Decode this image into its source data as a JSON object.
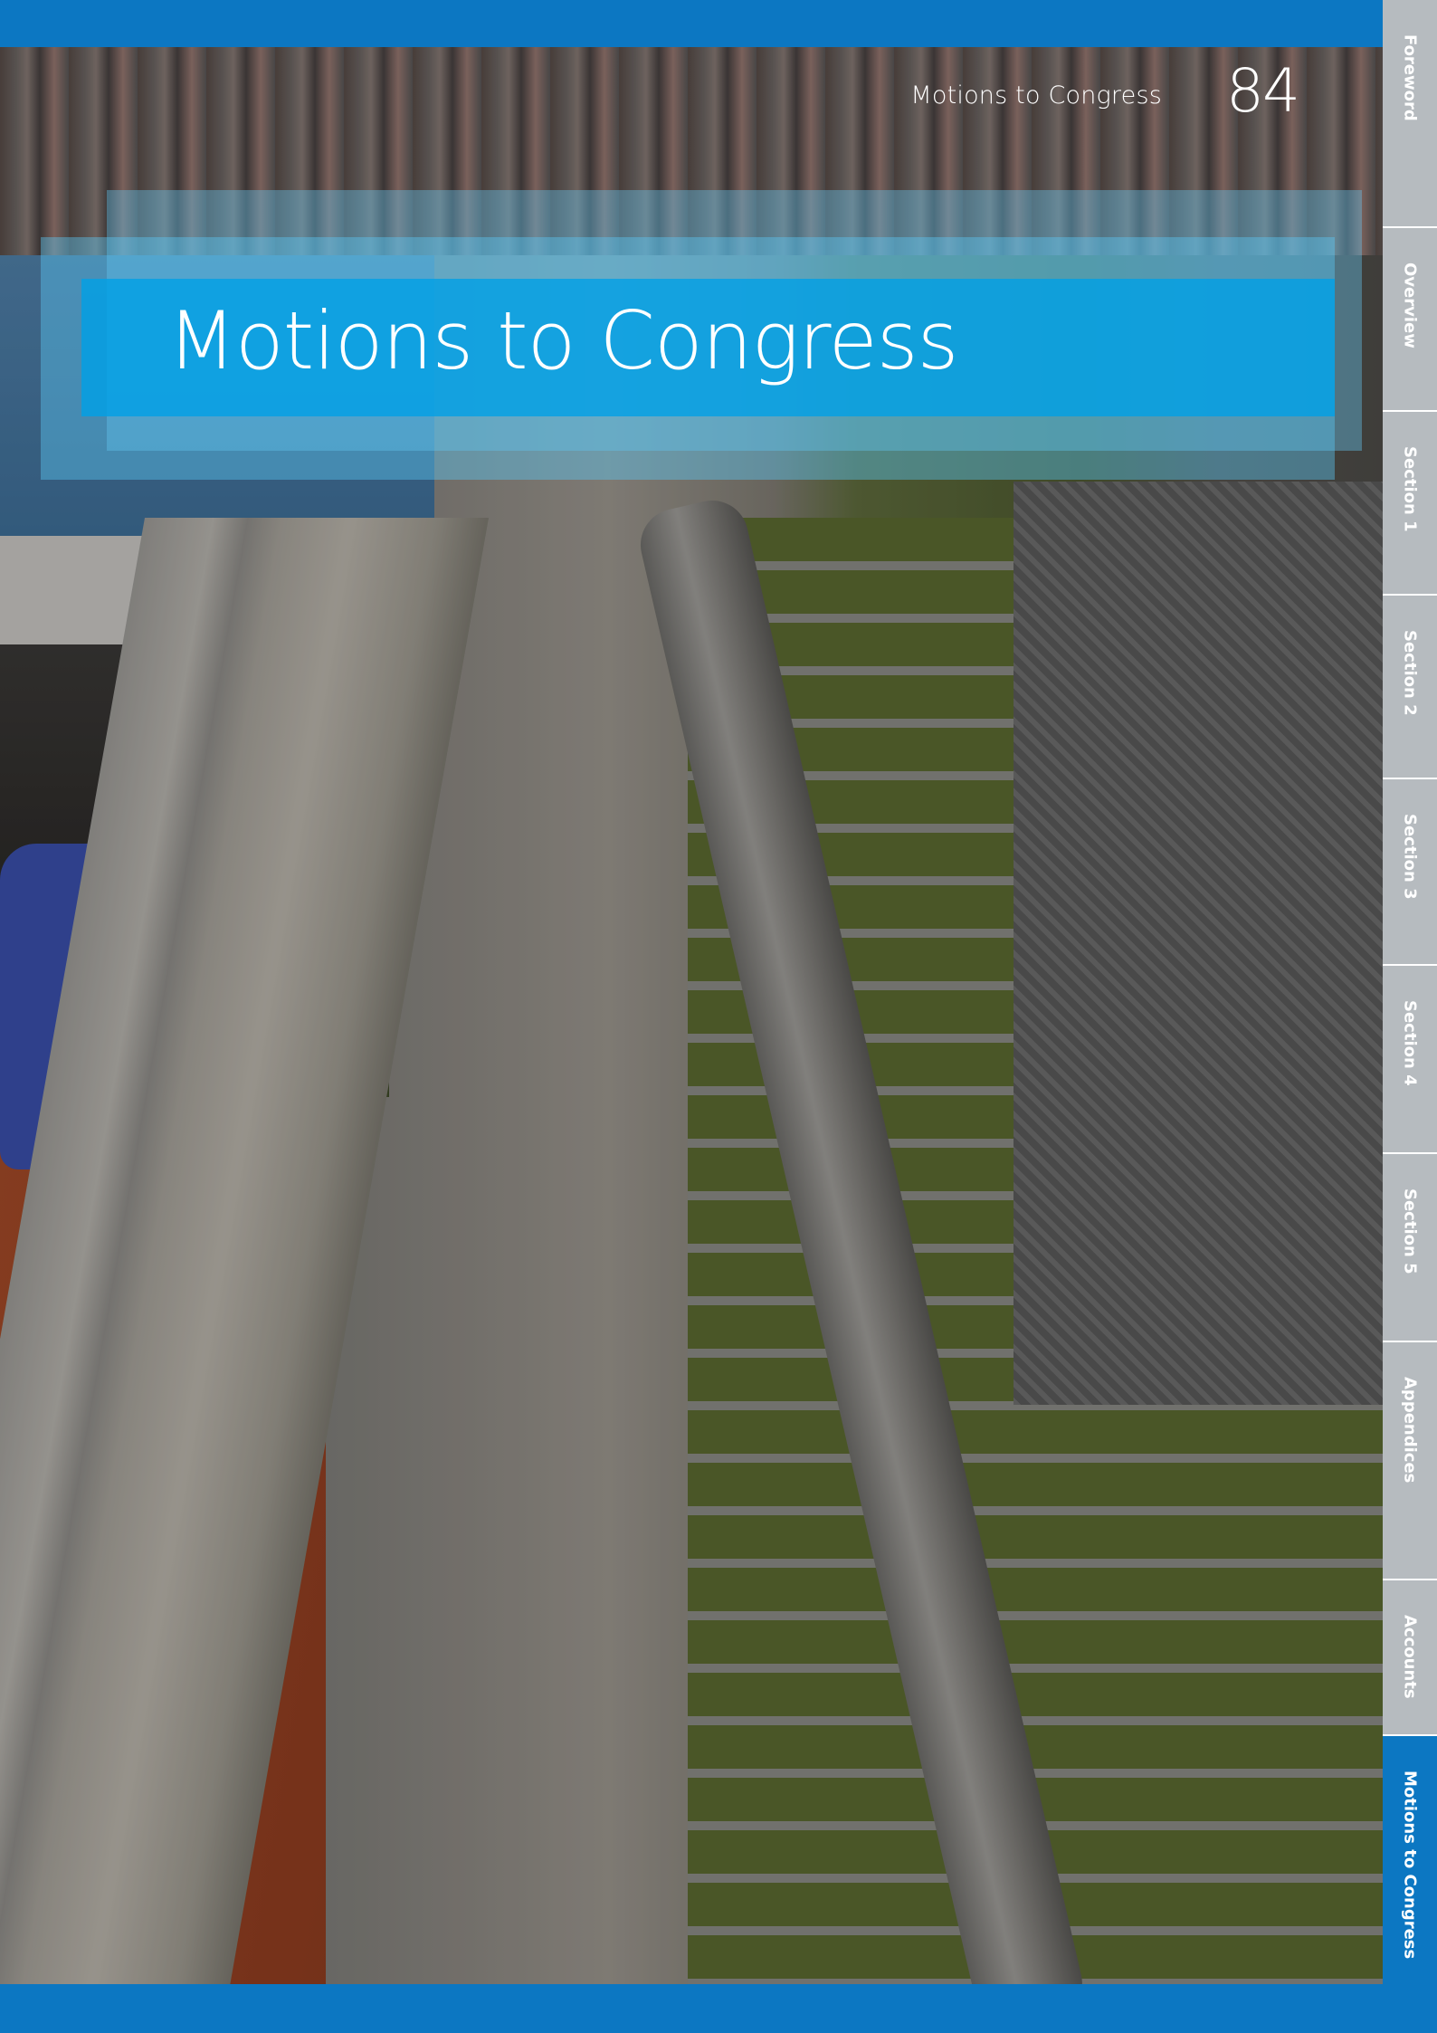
{
  "header": {
    "section_label": "Motions to Congress",
    "page_number": "84"
  },
  "banner": {
    "title": "Motions to Congress"
  },
  "sidenav": {
    "items": [
      {
        "label": "Foreword",
        "active": false
      },
      {
        "label": "Overview",
        "active": false
      },
      {
        "label": "Section 1",
        "active": false
      },
      {
        "label": "Section 2",
        "active": false
      },
      {
        "label": "Section 3",
        "active": false
      },
      {
        "label": "Section 4",
        "active": false
      },
      {
        "label": "Section 5",
        "active": false
      },
      {
        "label": "Appendices",
        "active": false
      },
      {
        "label": "Accounts",
        "active": false
      },
      {
        "label": "Motions to Congress",
        "active": true
      }
    ]
  },
  "colors": {
    "brand_blue": "#0c77c2",
    "banner_blue": "#00a0e6",
    "nav_grey": "#b6bbbf"
  }
}
